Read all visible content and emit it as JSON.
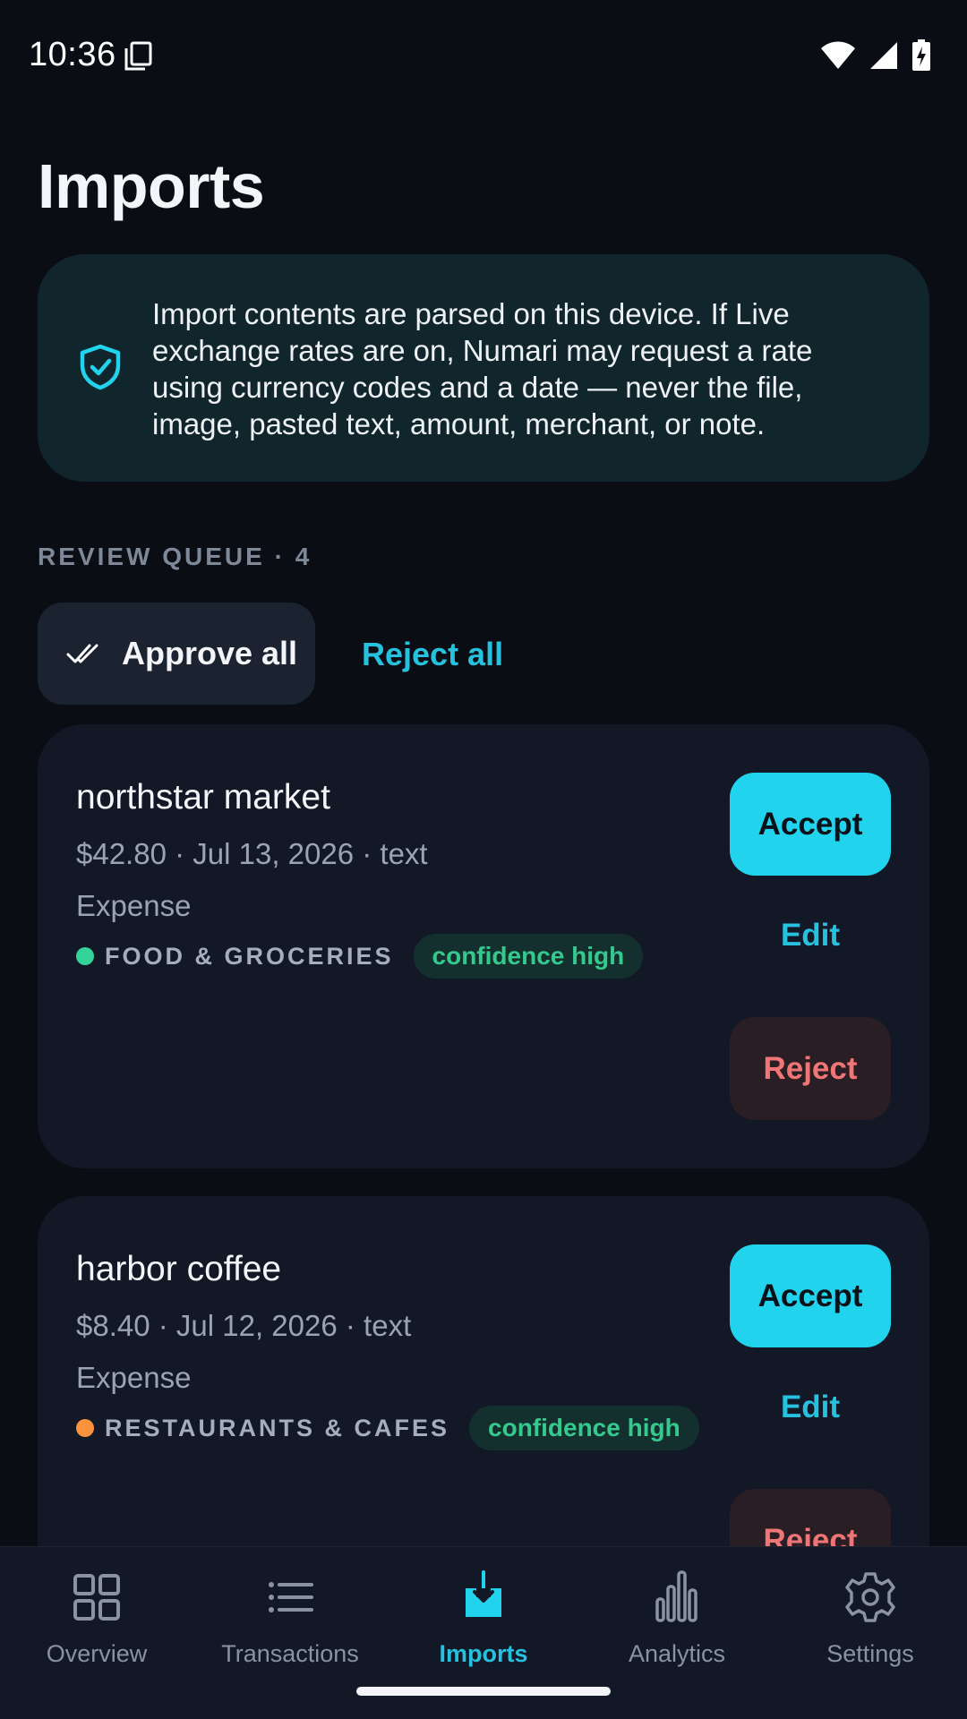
{
  "status_bar": {
    "time": "10:36"
  },
  "header": {
    "title": "Imports"
  },
  "privacy_notice": {
    "text": "Import contents are parsed on this device. If Live exchange rates are on, Numari may request a rate using currency codes and a date — never the file, image, pasted text, amount, merchant, or note."
  },
  "queue": {
    "header": "REVIEW QUEUE · 4",
    "approve_all_label": "Approve all",
    "reject_all_label": "Reject all",
    "items": [
      {
        "merchant": "northstar market",
        "meta": "$42.80 · Jul 13, 2026 · text",
        "kind": "Expense",
        "category": "FOOD & GROCERIES",
        "category_color": "#34d399",
        "confidence": "confidence high",
        "accept_label": "Accept",
        "edit_label": "Edit",
        "reject_label": "Reject"
      },
      {
        "merchant": "harbor coffee",
        "meta": "$8.40 · Jul 12, 2026 · text",
        "kind": "Expense",
        "category": "RESTAURANTS & CAFES",
        "category_color": "#fb923c",
        "confidence": "confidence high",
        "accept_label": "Accept",
        "edit_label": "Edit",
        "reject_label": "Reject"
      }
    ]
  },
  "nav": {
    "items": [
      {
        "label": "Overview",
        "icon": "grid-icon",
        "active": false
      },
      {
        "label": "Transactions",
        "icon": "list-icon",
        "active": false
      },
      {
        "label": "Imports",
        "icon": "import-icon",
        "active": true
      },
      {
        "label": "Analytics",
        "icon": "bar-chart-icon",
        "active": false
      },
      {
        "label": "Settings",
        "icon": "gear-icon",
        "active": false
      }
    ]
  },
  "colors": {
    "accent": "#22d3ee",
    "background": "#0a0d13",
    "card": "#121826",
    "danger": "#f07576",
    "success": "#35c98e"
  }
}
